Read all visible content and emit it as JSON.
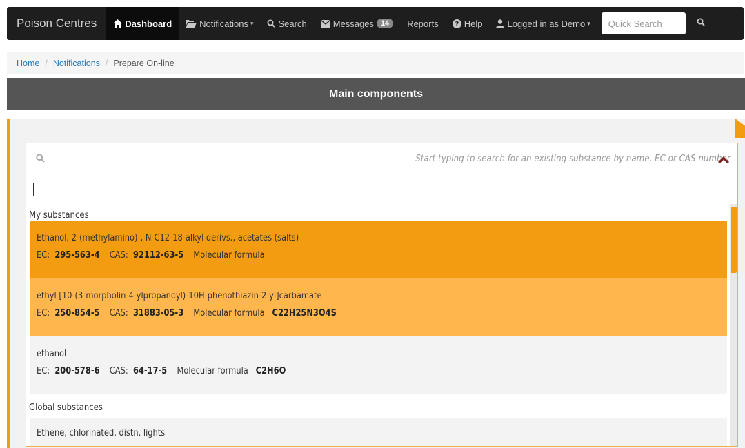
{
  "navbar": {
    "brand": "Poison Centres",
    "items": [
      {
        "label": "Dashboard",
        "icon": "home-icon",
        "active": true
      },
      {
        "label": "Notifications",
        "icon": "folder-open-icon",
        "dropdown": true
      },
      {
        "label": "Search",
        "icon": "search-icon"
      },
      {
        "label": "Messages",
        "icon": "envelope-icon",
        "badge": "14"
      },
      {
        "label": "Reports"
      },
      {
        "label": "Help",
        "icon": "question-circle-icon"
      },
      {
        "label": "Logged in as Demo",
        "icon": "user-icon",
        "dropdown": true
      }
    ],
    "quick_search_placeholder": "Quick Search"
  },
  "breadcrumb": {
    "home": "Home",
    "notifications": "Notifications",
    "current": "Prepare On-line"
  },
  "section": {
    "title": "Main components"
  },
  "search": {
    "hint": "Start typing to search for an existing substance by name, EC or CAS number",
    "value": ""
  },
  "results": {
    "my_label": "My substances",
    "global_label": "Global substances",
    "field_labels": {
      "ec": "EC:",
      "cas": "CAS:",
      "formula": "Molecular formula"
    },
    "my_substances": [
      {
        "name": "Ethanol, 2-(methylamino)-, N-C12-18-alkyl derivs., acetates (salts)",
        "ec": "295-563-4",
        "cas": "92112-63-5",
        "formula": ""
      },
      {
        "name": "ethyl [10-(3-morpholin-4-ylpropanoyl)-10H-phenothiazin-2-yl]carbamate",
        "ec": "250-854-5",
        "cas": "31883-05-3",
        "formula": "C22H25N3O4S"
      },
      {
        "name": "ethanol",
        "ec": "200-578-6",
        "cas": "64-17-5",
        "formula": "C2H6O"
      }
    ],
    "global_substances": [
      {
        "name": "Ethene, chlorinated, distn. lights"
      }
    ]
  },
  "colors": {
    "accent": "#f39c12",
    "hover": "#ffb74d",
    "navbar": "#1e1e1e",
    "header": "#555555"
  }
}
